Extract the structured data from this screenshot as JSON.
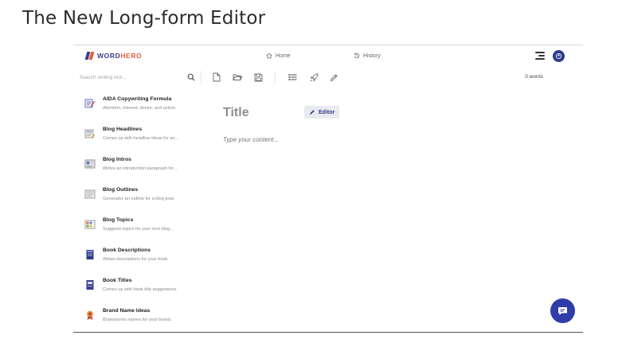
{
  "page_heading": "The New Long-form Editor",
  "app": {
    "logo": {
      "word": "WORD",
      "hero": "HERO"
    },
    "nav": {
      "home": "Home",
      "editor": "Editor",
      "history": "History"
    },
    "search": {
      "placeholder": "Search writing tool..."
    },
    "word_count": "0 words",
    "editor": {
      "title_placeholder": "Title",
      "content_placeholder": "Type your content..."
    },
    "tools": [
      {
        "name": "AIDA Copywriting Formula",
        "desc": "Attention, interest, desire, and action.",
        "icon": "aida-icon"
      },
      {
        "name": "Blog Headlines",
        "desc": "Comes up with headline ideas for an...",
        "icon": "blog-headlines-icon"
      },
      {
        "name": "Blog Intros",
        "desc": "Writes an introduction paragraph for...",
        "icon": "blog-intros-icon"
      },
      {
        "name": "Blog Outlines",
        "desc": "Generates an outline for a blog post.",
        "icon": "blog-outlines-icon"
      },
      {
        "name": "Blog Topics",
        "desc": "Suggests topics for your next blog...",
        "icon": "blog-topics-icon"
      },
      {
        "name": "Book Descriptions",
        "desc": "Writes descriptions for your book.",
        "icon": "book-descriptions-icon"
      },
      {
        "name": "Book Titles",
        "desc": "Comes up with book title suggestions.",
        "icon": "book-titles-icon"
      },
      {
        "name": "Brand Name Ideas",
        "desc": "Brainstorms names for your brand.",
        "icon": "brand-name-ideas-icon"
      }
    ],
    "colors": {
      "accent": "#2f3da8",
      "logo_word": "#3b3b8e",
      "logo_hero": "#e35a3c"
    }
  }
}
